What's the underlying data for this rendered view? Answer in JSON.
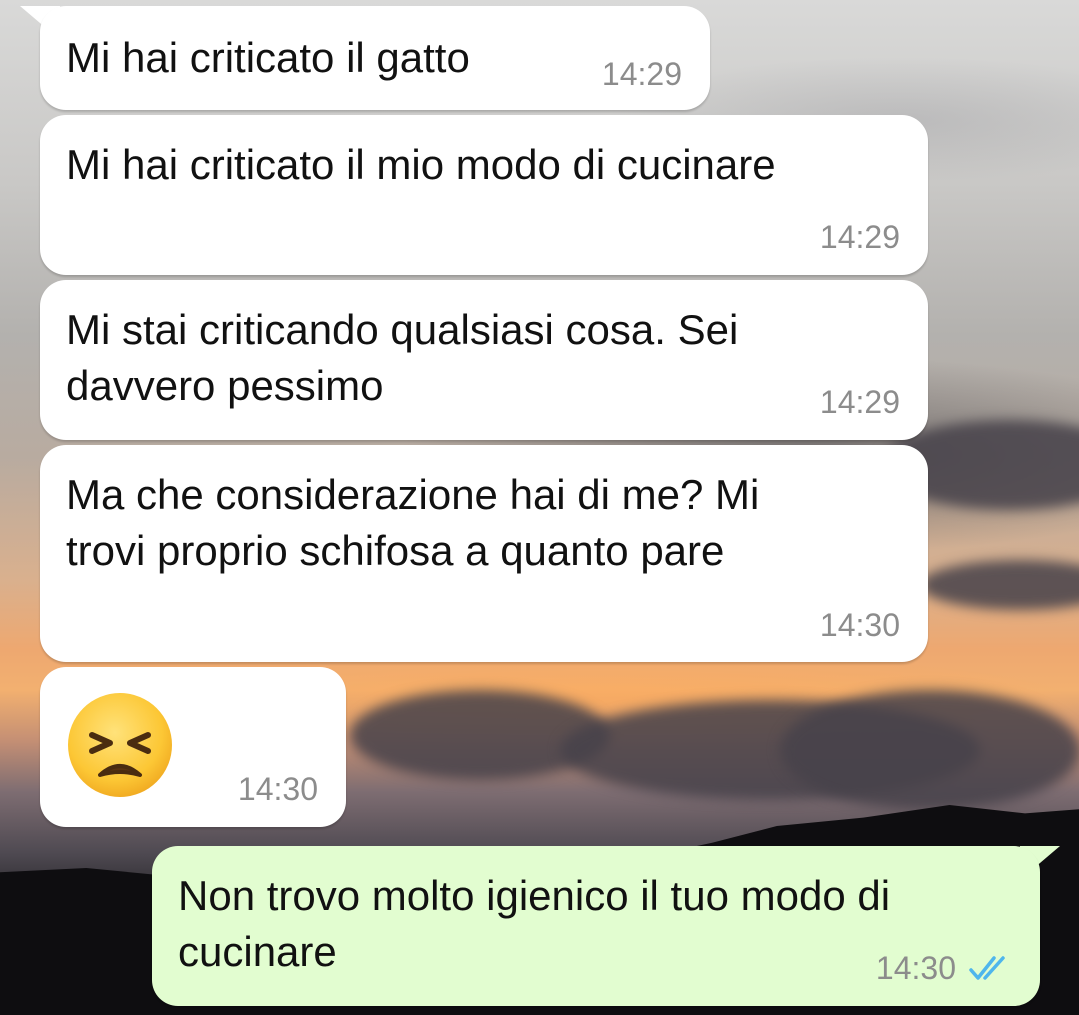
{
  "chat": {
    "messages": [
      {
        "direction": "incoming",
        "text": "Mi hai criticato il gatto",
        "time": "14:29"
      },
      {
        "direction": "incoming",
        "text": "Mi hai criticato il mio modo di cucinare",
        "time": "14:29"
      },
      {
        "direction": "incoming",
        "text": "Mi stai criticando qualsiasi cosa. Sei\ndavvero pessimo",
        "time": "14:29"
      },
      {
        "direction": "incoming",
        "text": "Ma che considerazione hai di me? Mi\ntrovi proprio schifosa a quanto pare",
        "time": "14:30"
      },
      {
        "direction": "incoming",
        "emoji": "persevering-face-emoji",
        "time": "14:30"
      },
      {
        "direction": "outgoing",
        "text": "Non trovo molto igienico il tuo modo di\ncucinare",
        "time": "14:30",
        "status": "read",
        "status_icon": "double-check-icon"
      }
    ]
  },
  "colors": {
    "incoming_bubble": "#ffffff",
    "outgoing_bubble": "#e2fdd0",
    "timestamp": "#8c8c8c",
    "read_ticks": "#4fb6ec"
  }
}
